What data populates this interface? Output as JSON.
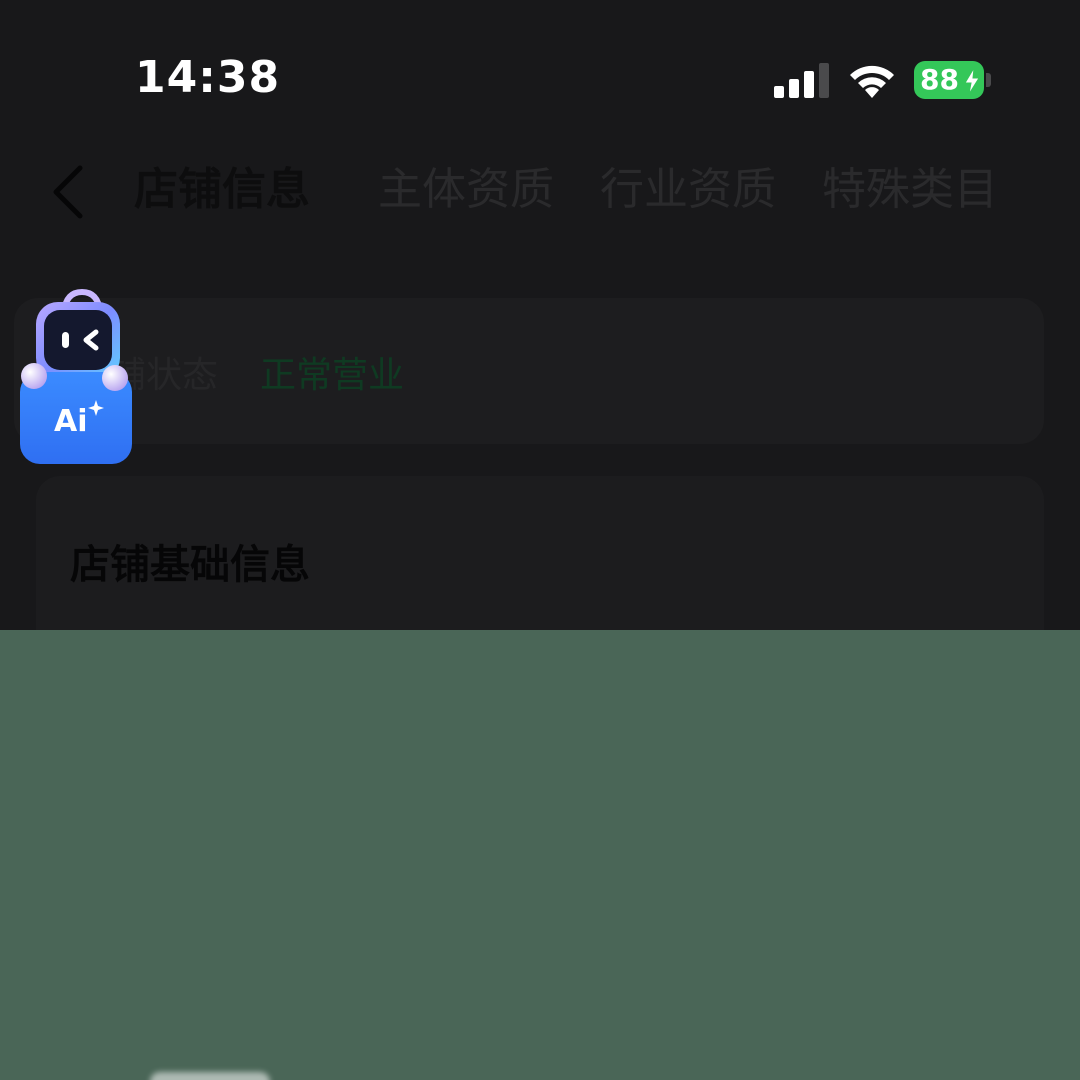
{
  "status_bar": {
    "time": "14:38",
    "battery_level": "88",
    "battery_color": "#34c759",
    "icons": [
      "signal-icon",
      "wifi-icon",
      "battery-icon",
      "charging-bolt-icon"
    ]
  },
  "nav": {
    "back_icon": "chevron-left-icon",
    "tabs": [
      {
        "label": "店铺信息",
        "active": true
      },
      {
        "label": "主体资质",
        "active": false
      },
      {
        "label": "行业资质",
        "active": false
      },
      {
        "label": "特殊类目",
        "active": false
      }
    ]
  },
  "store_status": {
    "label": "店铺状态",
    "value": "正常营业",
    "value_color": "#0f3a22"
  },
  "basic_info": {
    "title": "店铺基础信息"
  },
  "ai_assistant": {
    "badge_text": "Ai",
    "icon": "robot-assistant-icon"
  },
  "overlay": {
    "color": "#4a6657"
  }
}
